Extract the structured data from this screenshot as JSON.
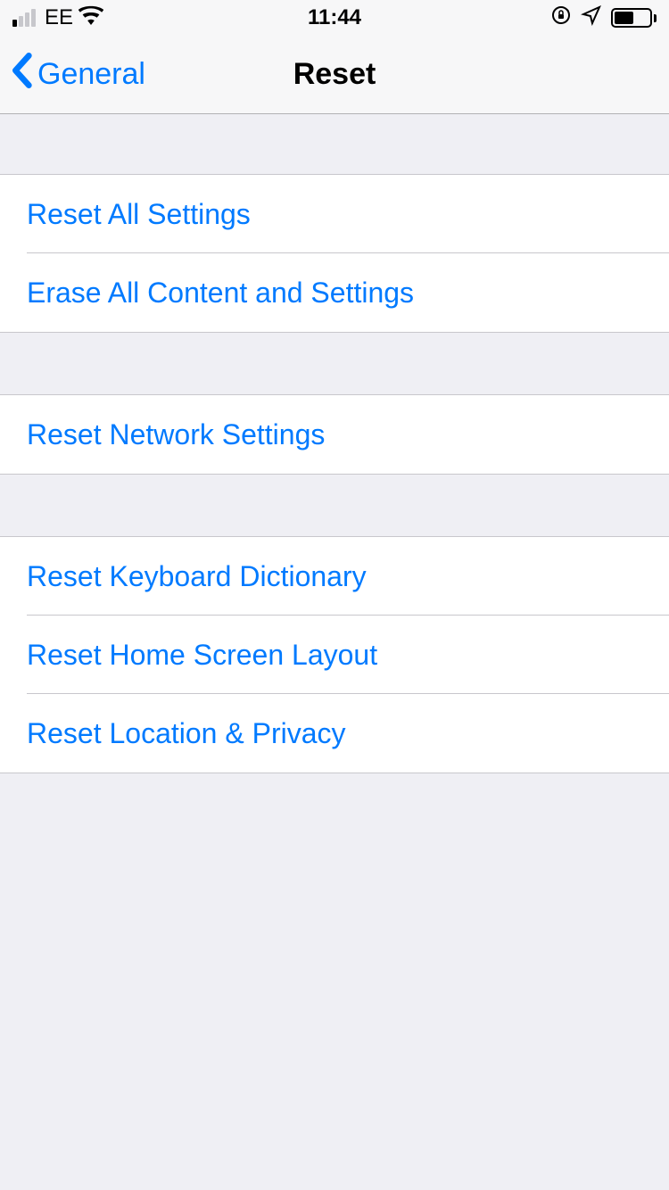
{
  "statusBar": {
    "carrier": "EE",
    "time": "11:44"
  },
  "navBar": {
    "backLabel": "General",
    "title": "Reset"
  },
  "groups": [
    {
      "items": [
        {
          "label": "Reset All Settings"
        },
        {
          "label": "Erase All Content and Settings"
        }
      ]
    },
    {
      "items": [
        {
          "label": "Reset Network Settings"
        }
      ]
    },
    {
      "items": [
        {
          "label": "Reset Keyboard Dictionary"
        },
        {
          "label": "Reset Home Screen Layout"
        },
        {
          "label": "Reset Location & Privacy"
        }
      ]
    }
  ]
}
